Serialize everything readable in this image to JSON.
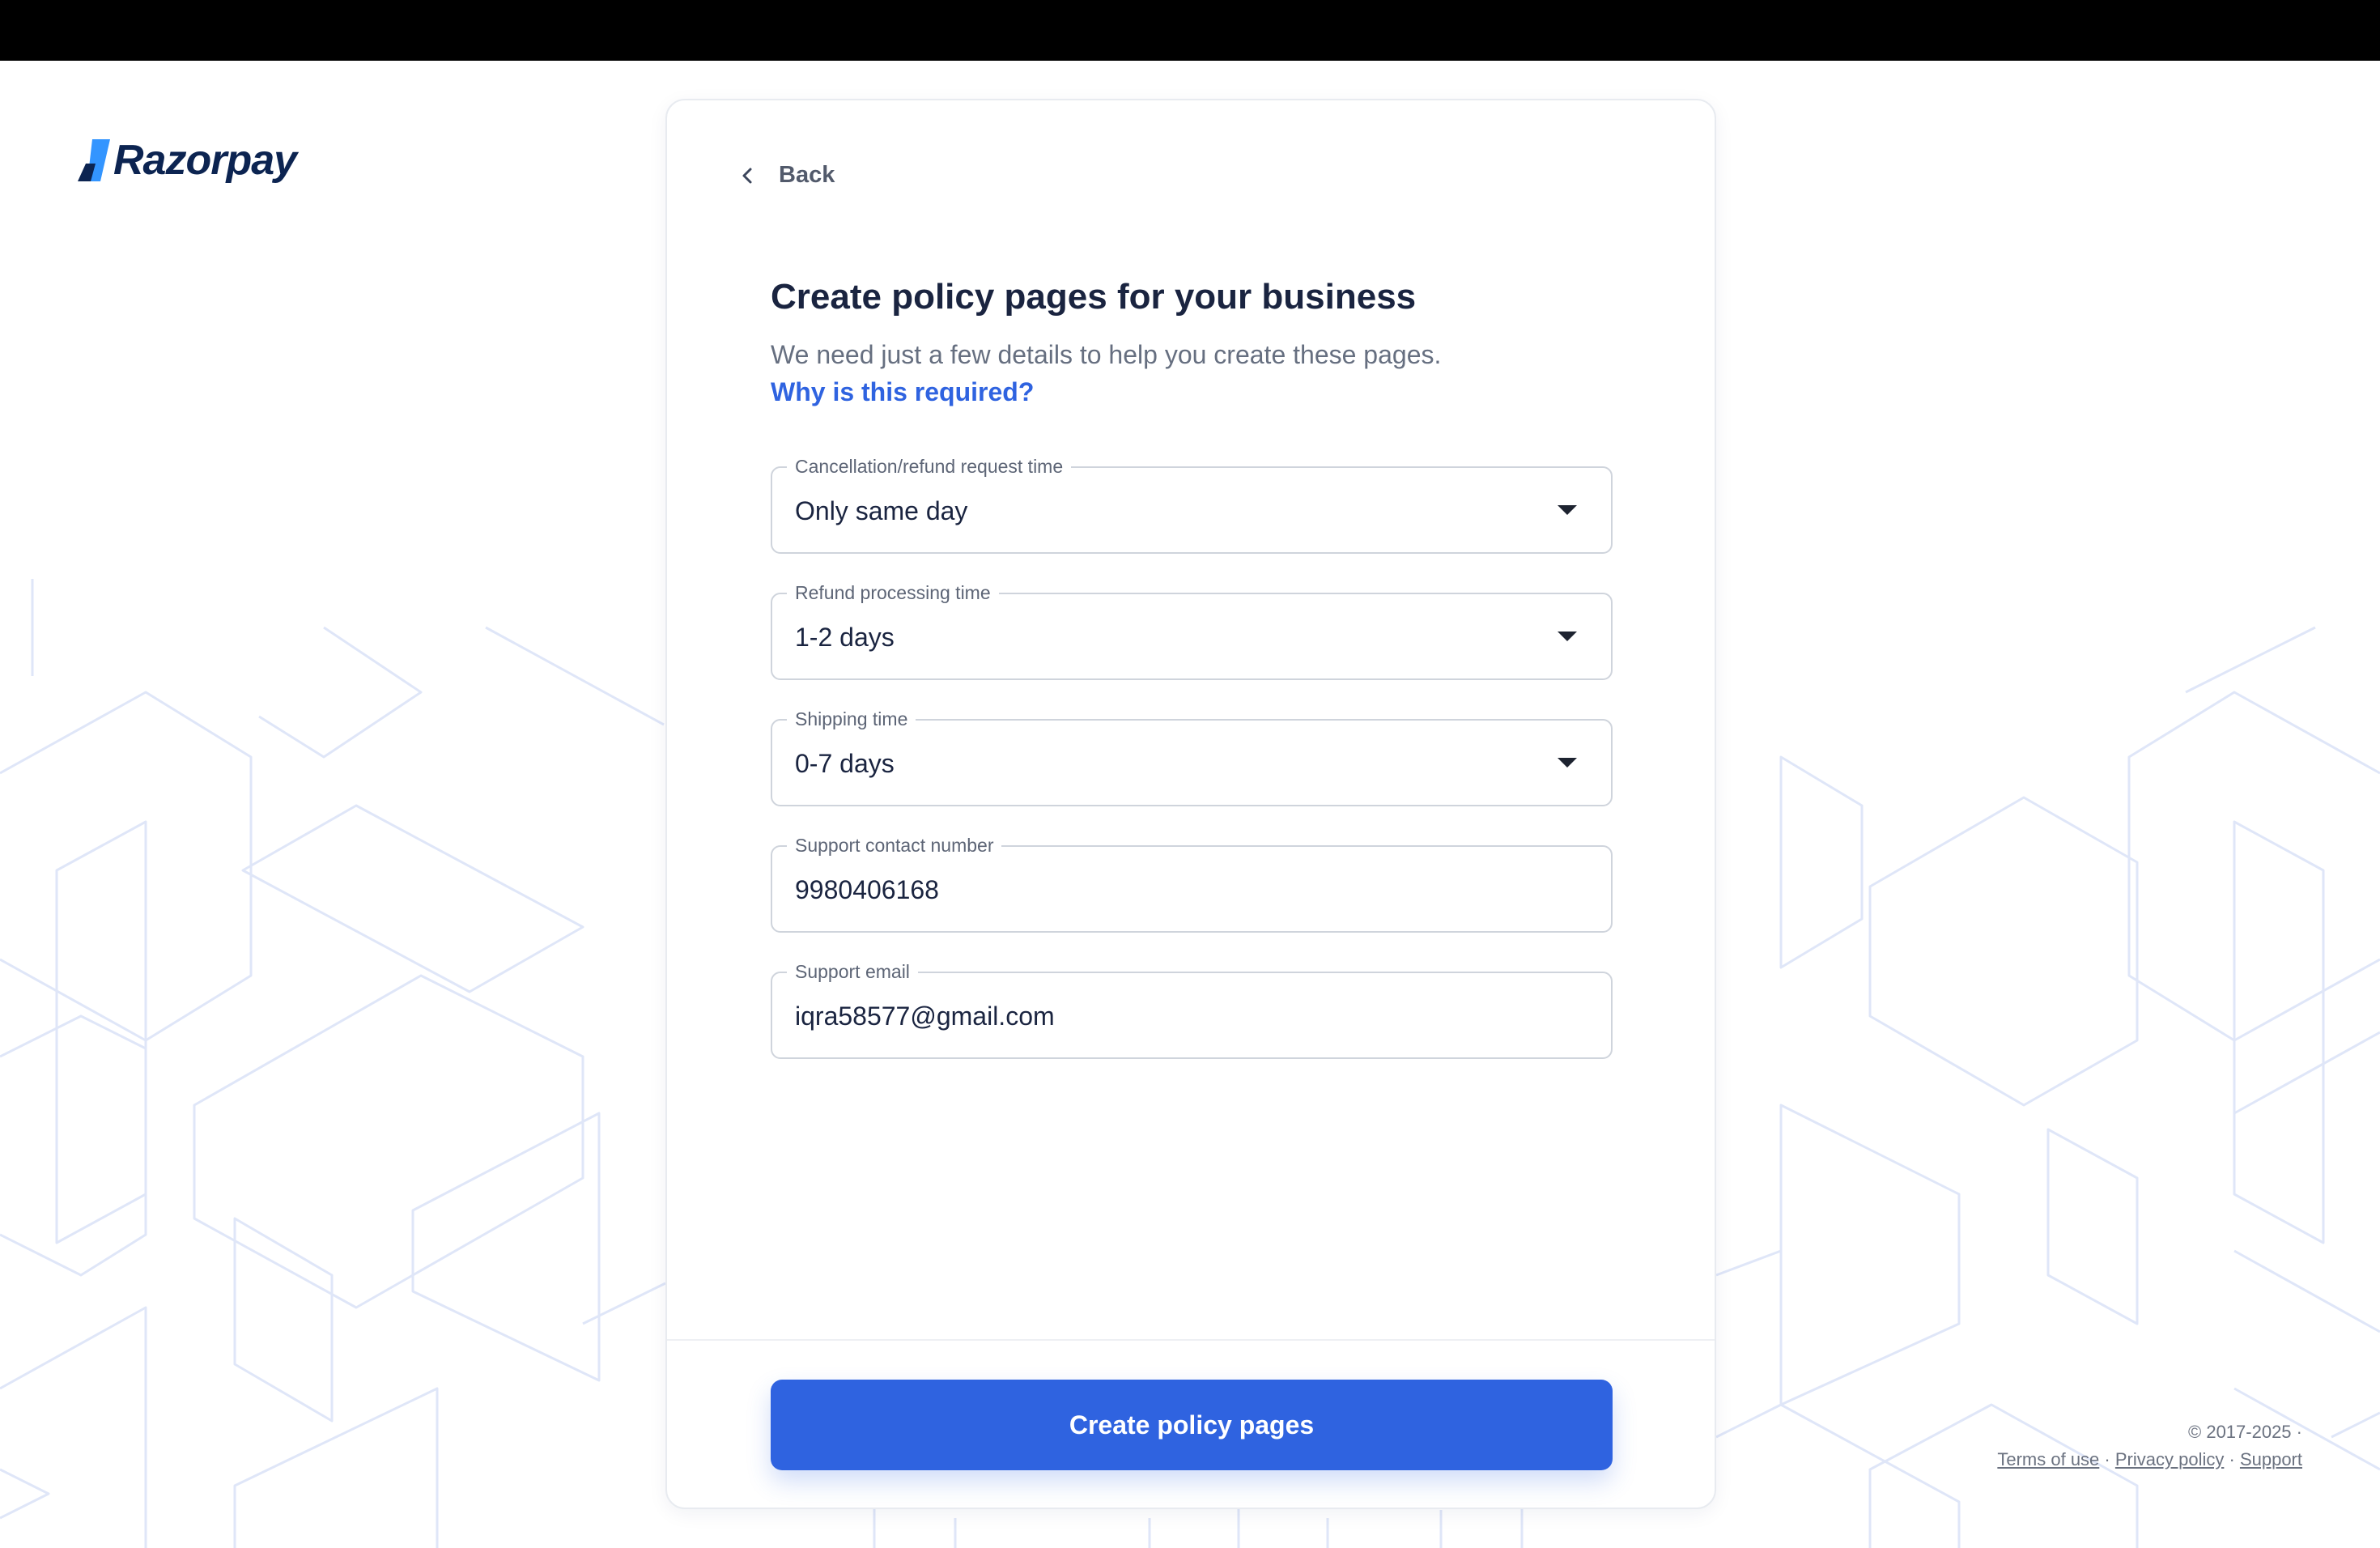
{
  "brand": {
    "name": "Razorpay"
  },
  "nav": {
    "back_label": "Back"
  },
  "page": {
    "title": "Create policy pages for your business",
    "subtitle": "We need just a few details to help you create these pages.",
    "why_link": "Why is this required?"
  },
  "form": {
    "fields": [
      {
        "label": "Cancellation/refund request time",
        "value": "Only same day",
        "type": "select"
      },
      {
        "label": "Refund processing time",
        "value": "1-2 days",
        "type": "select"
      },
      {
        "label": "Shipping time",
        "value": "0-7 days",
        "type": "select"
      },
      {
        "label": "Support contact number",
        "value": "9980406168",
        "type": "text"
      },
      {
        "label": "Support email",
        "value": "iqra58577@gmail.com",
        "type": "text"
      }
    ],
    "submit_label": "Create policy pages"
  },
  "footer": {
    "copyright": "© 2017-2025 ·",
    "terms": "Terms of use",
    "privacy": "Privacy policy",
    "support": "Support",
    "separator": "·"
  },
  "colors": {
    "primary": "#2f63e0",
    "heading": "#1a2440",
    "brand_dark": "#0c2451",
    "topbar": "#000000"
  }
}
